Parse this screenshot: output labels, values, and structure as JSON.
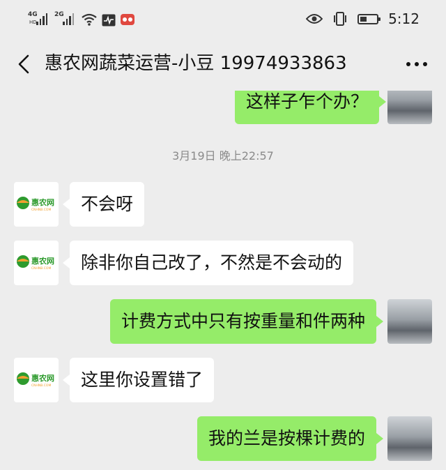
{
  "status_bar": {
    "network1": "4G",
    "network1_sub": "HD",
    "network2": "2G",
    "icons": [
      "eye-comfort-icon",
      "vibrate-icon",
      "battery-icon",
      "wifi-icon",
      "activity-icon",
      "app-notification-icon"
    ],
    "time": "5:12"
  },
  "nav": {
    "title": "惠农网蔬菜运营-小豆 19974933863",
    "back_icon": "chevron-left-icon",
    "more_icon": "more-dots-icon"
  },
  "chat": {
    "timestamp": "3月19日 晚上22:57",
    "messages": [
      {
        "side": "right",
        "text": "这样子乍个办？"
      },
      {
        "side": "left",
        "text": "不会呀"
      },
      {
        "side": "left",
        "text": "除非你自己改了，不然是不会动的"
      },
      {
        "side": "right",
        "text": "计费方式中只有按重量和件两种"
      },
      {
        "side": "left",
        "text": "这里你设置错了"
      },
      {
        "side": "right",
        "text": "我的兰是按棵计费的"
      }
    ],
    "contact_logo": {
      "name": "惠农网",
      "domain": "CNHNB.COM"
    }
  },
  "colors": {
    "background": "#ededed",
    "bubble_self": "#95ec69",
    "bubble_other": "#ffffff",
    "brand_green": "#2e9b2e",
    "brand_orange": "#f0a030"
  }
}
